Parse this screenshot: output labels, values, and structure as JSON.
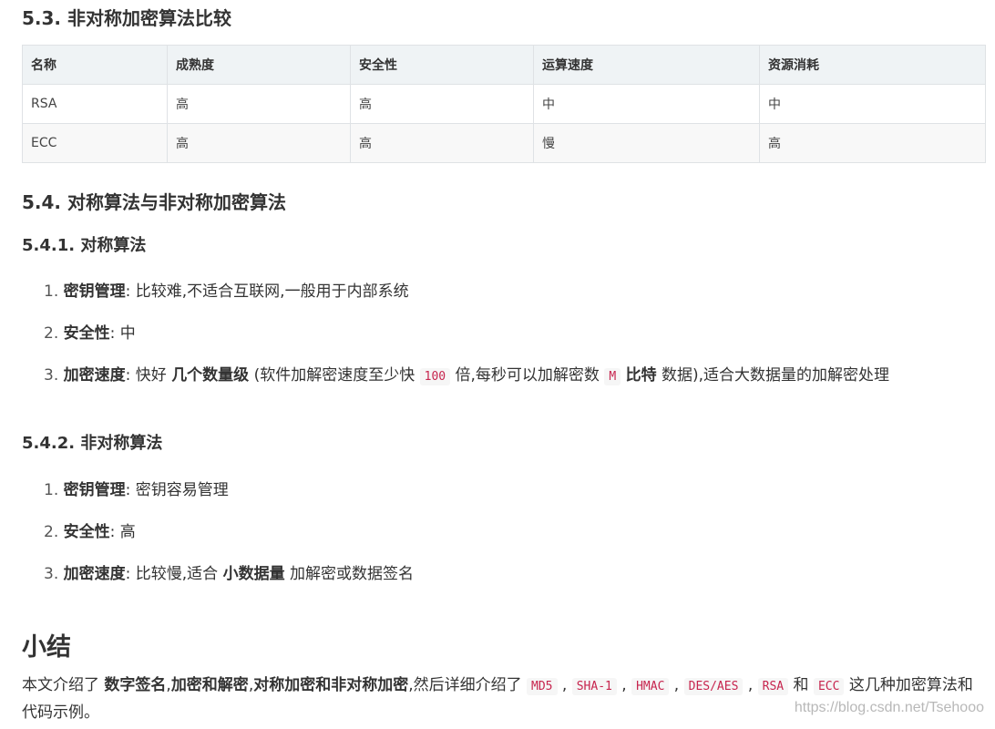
{
  "sec53": {
    "title": "5.3. 非对称加密算法比较"
  },
  "table": {
    "headers": [
      "名称",
      "成熟度",
      "安全性",
      "运算速度",
      "资源消耗"
    ],
    "rows": [
      [
        "RSA",
        "高",
        "高",
        "中",
        "中"
      ],
      [
        "ECC",
        "高",
        "高",
        "慢",
        "高"
      ]
    ]
  },
  "sec54": {
    "title": "5.4. 对称算法与非对称加密算法"
  },
  "sec541": {
    "title": "5.4.1. 对称算法",
    "items": [
      {
        "num": "1.",
        "label": "密钥管理",
        "sep": ":",
        "text": "比较难,不适合互联网,一般用于内部系统"
      },
      {
        "num": "2.",
        "label": "安全性",
        "sep": ":",
        "text": "中"
      },
      {
        "num": "3.",
        "label": "加密速度",
        "sep": ":",
        "text_a": "快好 ",
        "bold_a": "几个数量级",
        "text_b": " (软件加解密速度至少快 ",
        "code_a": "100",
        "text_c": " 倍,每秒可以加解密数 ",
        "code_b": "M",
        "text_d": " ",
        "bold_b": "比特",
        "text_e": " 数据),适合大数据量的加解密处理"
      }
    ]
  },
  "sec542": {
    "title": "5.4.2. 非对称算法",
    "items": [
      {
        "num": "1.",
        "label": "密钥管理",
        "sep": ":",
        "text": "密钥容易管理"
      },
      {
        "num": "2.",
        "label": "安全性",
        "sep": ":",
        "text": "高"
      },
      {
        "num": "3.",
        "label": "加密速度",
        "sep": ":",
        "text_a": "比较慢,适合 ",
        "bold_a": "小数据量",
        "text_b": " 加解密或数据签名"
      }
    ]
  },
  "summary": {
    "title": "小结",
    "p1": "本文介绍了 ",
    "b1": "数字签名",
    "p2": ",",
    "b2": "加密和解密",
    "p3": ",",
    "b3": "对称加密和非对称加密",
    "p4": ",然后详细介绍了 ",
    "c1": "MD5",
    "s1": " , ",
    "c2": "SHA-1",
    "s2": " , ",
    "c3": "HMAC",
    "s3": " , ",
    "c4": "DES/AES",
    "s4": " , ",
    "c5": "RSA",
    "s5": " 和 ",
    "c6": "ECC",
    "p5": " 这几种加密算法和代码示例。"
  },
  "watermark": "https://blog.csdn.net/Tsehooo"
}
